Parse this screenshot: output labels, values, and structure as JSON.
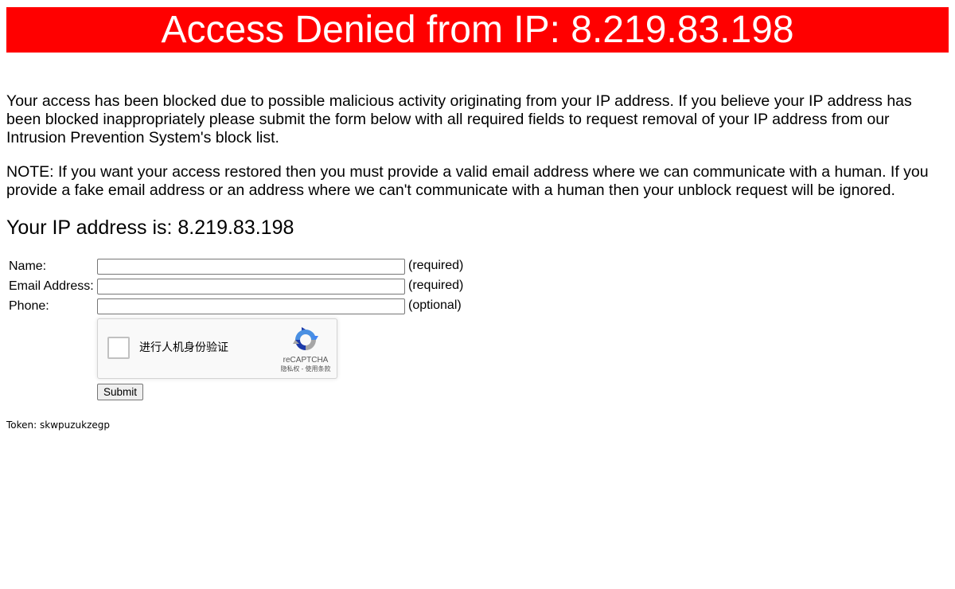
{
  "banner": {
    "title": "Access Denied from IP: 8.219.83.198",
    "background_color": "#ff0000",
    "text_color": "#ffffff"
  },
  "message": {
    "paragraph1": "Your access has been blocked due to possible malicious activity originating from your IP address. If you believe your IP address has been blocked inappropriately please submit the form below with all required fields to request removal of your IP address from our Intrusion Prevention System's block list.",
    "paragraph2": "NOTE: If you want your access restored then you must provide a valid email address where we can communicate with a human. If you provide a fake email address or an address where we can't communicate with a human then your unblock request will be ignored."
  },
  "ip_heading": "Your IP address is: 8.219.83.198",
  "form": {
    "fields": [
      {
        "label": "Name:",
        "value": "",
        "hint": "(required)"
      },
      {
        "label": "Email Address:",
        "value": "",
        "hint": "(required)"
      },
      {
        "label": "Phone:",
        "value": "",
        "hint": "(optional)"
      }
    ],
    "captcha": {
      "label": "进行人机身份验证",
      "brand": "reCAPTCHA",
      "links": "隐私权 - 使用条款",
      "icon": "recaptcha-logo-icon",
      "checked": false
    },
    "submit_label": "Submit"
  },
  "token": "Token: skwpuzukzegp"
}
